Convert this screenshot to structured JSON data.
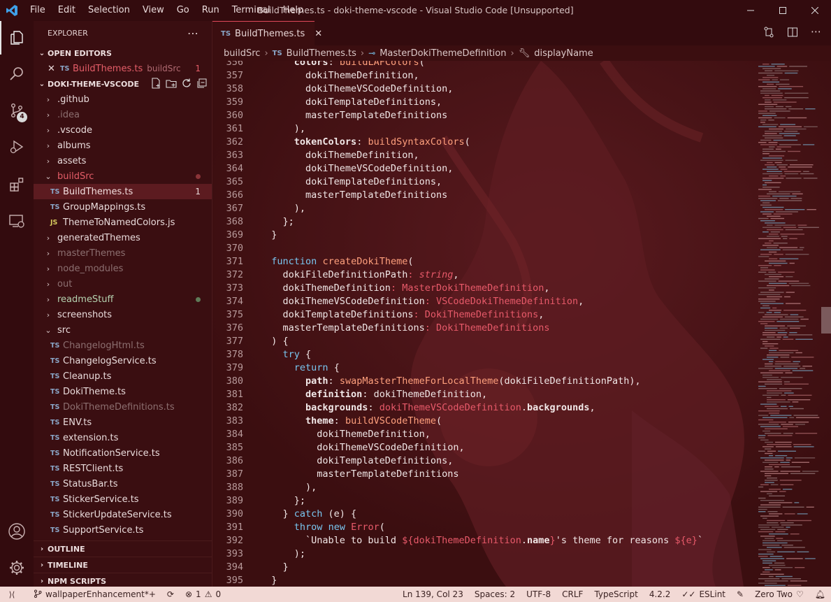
{
  "window": {
    "title": "BuildThemes.ts - doki-theme-vscode - Visual Studio Code [Unsupported]",
    "menu": [
      "File",
      "Edit",
      "Selection",
      "View",
      "Go",
      "Run",
      "Terminal",
      "Help"
    ]
  },
  "activity_badge": "4",
  "explorer": {
    "title": "EXPLORER",
    "open_editors": {
      "heading": "OPEN EDITORS",
      "items": [
        {
          "icon": "TS",
          "name": "BuildThemes.ts",
          "folder": "buildSrc",
          "count": "1"
        }
      ]
    },
    "workspace": "DOKI-THEME-VSCODE",
    "tree": [
      {
        "label": ".github",
        "kind": "folder-closed",
        "state": "normal"
      },
      {
        "label": ".idea",
        "kind": "folder-closed",
        "state": "dim"
      },
      {
        "label": ".vscode",
        "kind": "folder-closed",
        "state": "normal"
      },
      {
        "label": "albums",
        "kind": "folder-closed",
        "state": "normal"
      },
      {
        "label": "assets",
        "kind": "folder-closed",
        "state": "normal"
      },
      {
        "label": "buildSrc",
        "kind": "folder-open",
        "state": "modified"
      },
      {
        "label": "BuildThemes.ts",
        "kind": "ts",
        "state": "selected",
        "count": "1"
      },
      {
        "label": "GroupMappings.ts",
        "kind": "ts",
        "state": "normal"
      },
      {
        "label": "ThemeToNamedColors.js",
        "kind": "js",
        "state": "normal"
      },
      {
        "label": "generatedThemes",
        "kind": "folder-closed",
        "state": "normal"
      },
      {
        "label": "masterThemes",
        "kind": "folder-closed",
        "state": "dim"
      },
      {
        "label": "node_modules",
        "kind": "folder-closed",
        "state": "dim"
      },
      {
        "label": "out",
        "kind": "folder-closed",
        "state": "dim"
      },
      {
        "label": "readmeStuff",
        "kind": "folder-closed",
        "state": "added"
      },
      {
        "label": "screenshots",
        "kind": "folder-closed",
        "state": "normal"
      },
      {
        "label": "src",
        "kind": "folder-open",
        "state": "normal"
      },
      {
        "label": "ChangelogHtml.ts",
        "kind": "ts",
        "state": "dim"
      },
      {
        "label": "ChangelogService.ts",
        "kind": "ts",
        "state": "normal"
      },
      {
        "label": "Cleanup.ts",
        "kind": "ts",
        "state": "normal"
      },
      {
        "label": "DokiTheme.ts",
        "kind": "ts",
        "state": "normal"
      },
      {
        "label": "DokiThemeDefinitions.ts",
        "kind": "ts",
        "state": "dim"
      },
      {
        "label": "ENV.ts",
        "kind": "ts",
        "state": "normal"
      },
      {
        "label": "extension.ts",
        "kind": "ts",
        "state": "normal"
      },
      {
        "label": "NotificationService.ts",
        "kind": "ts",
        "state": "normal"
      },
      {
        "label": "RESTClient.ts",
        "kind": "ts",
        "state": "normal"
      },
      {
        "label": "StatusBar.ts",
        "kind": "ts",
        "state": "normal"
      },
      {
        "label": "StickerService.ts",
        "kind": "ts",
        "state": "normal"
      },
      {
        "label": "StickerUpdateService.ts",
        "kind": "ts",
        "state": "normal"
      },
      {
        "label": "SupportService.ts",
        "kind": "ts",
        "state": "normal"
      }
    ],
    "bottom_sections": [
      "OUTLINE",
      "TIMELINE",
      "NPM SCRIPTS"
    ]
  },
  "editor": {
    "tab": {
      "icon": "TS",
      "label": "BuildThemes.ts"
    },
    "breadcrumbs": [
      "buildSrc",
      "BuildThemes.ts",
      "MasterDokiThemeDefinition",
      "displayName"
    ],
    "lines": [
      {
        "n": "356",
        "t": [
          [
            "      ",
            ""
          ],
          [
            "colors",
            "pr"
          ],
          [
            ": ",
            ""
          ],
          [
            "buildLAFColors",
            "fn"
          ],
          [
            "(",
            ""
          ]
        ]
      },
      {
        "n": "357",
        "t": [
          [
            "        dokiThemeDefinition,",
            ""
          ]
        ]
      },
      {
        "n": "358",
        "t": [
          [
            "        dokiThemeVSCodeDefinition,",
            ""
          ]
        ]
      },
      {
        "n": "359",
        "t": [
          [
            "        dokiTemplateDefinitions,",
            ""
          ]
        ]
      },
      {
        "n": "360",
        "t": [
          [
            "        masterTemplateDefinitions",
            ""
          ]
        ]
      },
      {
        "n": "361",
        "t": [
          [
            "      ),",
            ""
          ]
        ]
      },
      {
        "n": "362",
        "t": [
          [
            "      ",
            ""
          ],
          [
            "tokenColors",
            "pr"
          ],
          [
            ": ",
            ""
          ],
          [
            "buildSyntaxColors",
            "fn"
          ],
          [
            "(",
            ""
          ]
        ]
      },
      {
        "n": "363",
        "t": [
          [
            "        dokiThemeDefinition,",
            ""
          ]
        ]
      },
      {
        "n": "364",
        "t": [
          [
            "        dokiThemeVSCodeDefinition,",
            ""
          ]
        ]
      },
      {
        "n": "365",
        "t": [
          [
            "        dokiTemplateDefinitions,",
            ""
          ]
        ]
      },
      {
        "n": "366",
        "t": [
          [
            "        masterTemplateDefinitions",
            ""
          ]
        ]
      },
      {
        "n": "367",
        "t": [
          [
            "      ),",
            ""
          ]
        ]
      },
      {
        "n": "368",
        "t": [
          [
            "    };",
            ""
          ]
        ]
      },
      {
        "n": "369",
        "t": [
          [
            "  }",
            ""
          ]
        ]
      },
      {
        "n": "370",
        "t": [
          [
            "",
            ""
          ]
        ]
      },
      {
        "n": "371",
        "t": [
          [
            "  ",
            ""
          ],
          [
            "function",
            "kw"
          ],
          [
            " ",
            ""
          ],
          [
            "createDokiTheme",
            "fn"
          ],
          [
            "(",
            ""
          ]
        ]
      },
      {
        "n": "372",
        "t": [
          [
            "    dokiFileDefinitionPath",
            ""
          ],
          [
            ": ",
            "tp"
          ],
          [
            "string",
            "tyi"
          ],
          [
            ",",
            ""
          ]
        ]
      },
      {
        "n": "373",
        "t": [
          [
            "    dokiThemeDefinition",
            ""
          ],
          [
            ": ",
            "tp"
          ],
          [
            "MasterDokiThemeDefinition",
            "ty"
          ],
          [
            ",",
            ""
          ]
        ]
      },
      {
        "n": "374",
        "t": [
          [
            "    dokiThemeVSCodeDefinition",
            ""
          ],
          [
            ": ",
            "tp"
          ],
          [
            "VSCodeDokiThemeDefinition",
            "ty"
          ],
          [
            ",",
            ""
          ]
        ]
      },
      {
        "n": "375",
        "t": [
          [
            "    dokiTemplateDefinitions",
            ""
          ],
          [
            ": ",
            "tp"
          ],
          [
            "DokiThemeDefinitions",
            "ty"
          ],
          [
            ",",
            ""
          ]
        ]
      },
      {
        "n": "376",
        "t": [
          [
            "    masterTemplateDefinitions",
            ""
          ],
          [
            ": ",
            "tp"
          ],
          [
            "DokiThemeDefinitions",
            "ty"
          ]
        ]
      },
      {
        "n": "377",
        "t": [
          [
            "  ) {",
            ""
          ]
        ]
      },
      {
        "n": "378",
        "t": [
          [
            "    ",
            ""
          ],
          [
            "try",
            "kw"
          ],
          [
            " {",
            ""
          ]
        ]
      },
      {
        "n": "379",
        "t": [
          [
            "      ",
            ""
          ],
          [
            "return",
            "kw"
          ],
          [
            " {",
            ""
          ]
        ]
      },
      {
        "n": "380",
        "t": [
          [
            "        ",
            ""
          ],
          [
            "path",
            "pr"
          ],
          [
            ": ",
            ""
          ],
          [
            "swapMasterThemeForLocalTheme",
            "fn"
          ],
          [
            "(dokiFileDefinitionPath),",
            ""
          ]
        ]
      },
      {
        "n": "381",
        "t": [
          [
            "        ",
            ""
          ],
          [
            "definition",
            "pr"
          ],
          [
            ": dokiThemeDefinition,",
            ""
          ]
        ]
      },
      {
        "n": "382",
        "t": [
          [
            "        ",
            ""
          ],
          [
            "backgrounds",
            "pr"
          ],
          [
            ": ",
            ""
          ],
          [
            "dokiThemeVSCodeDefinition",
            "ty"
          ],
          [
            ".",
            ""
          ],
          [
            "backgrounds",
            "pr"
          ],
          [
            ",",
            ""
          ]
        ]
      },
      {
        "n": "383",
        "t": [
          [
            "        ",
            ""
          ],
          [
            "theme",
            "pr"
          ],
          [
            ": ",
            ""
          ],
          [
            "buildVSCodeTheme",
            "fn"
          ],
          [
            "(",
            ""
          ]
        ]
      },
      {
        "n": "384",
        "t": [
          [
            "          dokiThemeDefinition,",
            ""
          ]
        ]
      },
      {
        "n": "385",
        "t": [
          [
            "          dokiThemeVSCodeDefinition,",
            ""
          ]
        ]
      },
      {
        "n": "386",
        "t": [
          [
            "          dokiTemplateDefinitions,",
            ""
          ]
        ]
      },
      {
        "n": "387",
        "t": [
          [
            "          masterTemplateDefinitions",
            ""
          ]
        ]
      },
      {
        "n": "388",
        "t": [
          [
            "        ),",
            ""
          ]
        ]
      },
      {
        "n": "389",
        "t": [
          [
            "      };",
            ""
          ]
        ]
      },
      {
        "n": "390",
        "t": [
          [
            "    } ",
            ""
          ],
          [
            "catch",
            "kw"
          ],
          [
            " (e) {",
            ""
          ]
        ]
      },
      {
        "n": "391",
        "t": [
          [
            "      ",
            ""
          ],
          [
            "throw",
            "kw"
          ],
          [
            " ",
            ""
          ],
          [
            "new",
            "kw"
          ],
          [
            " ",
            ""
          ],
          [
            "Error",
            "ty"
          ],
          [
            "(",
            ""
          ]
        ]
      },
      {
        "n": "392",
        "t": [
          [
            "        `Unable to build ",
            "str"
          ],
          [
            "${",
            "tp"
          ],
          [
            "dokiThemeDefinition",
            "ty"
          ],
          [
            ".",
            ""
          ],
          [
            "name",
            "pr"
          ],
          [
            "}",
            "tp"
          ],
          [
            "'s theme for reasons ",
            "str"
          ],
          [
            "${",
            "tp"
          ],
          [
            "e",
            "ty"
          ],
          [
            "}",
            "tp"
          ],
          [
            "`",
            "str"
          ]
        ]
      },
      {
        "n": "393",
        "t": [
          [
            "      );",
            ""
          ]
        ]
      },
      {
        "n": "394",
        "t": [
          [
            "    }",
            ""
          ]
        ]
      },
      {
        "n": "395",
        "t": [
          [
            "  }",
            ""
          ]
        ]
      }
    ]
  },
  "status": {
    "branch": "wallpaperEnhancement*+",
    "errors": "1",
    "warnings": "0",
    "position": "Ln 139, Col 23",
    "spaces": "Spaces: 2",
    "encoding": "UTF-8",
    "eol": "CRLF",
    "language": "TypeScript",
    "version": "4.2.2",
    "eslint": "ESLint",
    "theme": "Zero Two"
  },
  "colors": {
    "background": "#3b0e10",
    "accent": "#e0485a",
    "statusbar": "#f2d9d5",
    "keyword": "#79c6f0",
    "function": "#ffa07d",
    "type": "#e85a6a"
  }
}
